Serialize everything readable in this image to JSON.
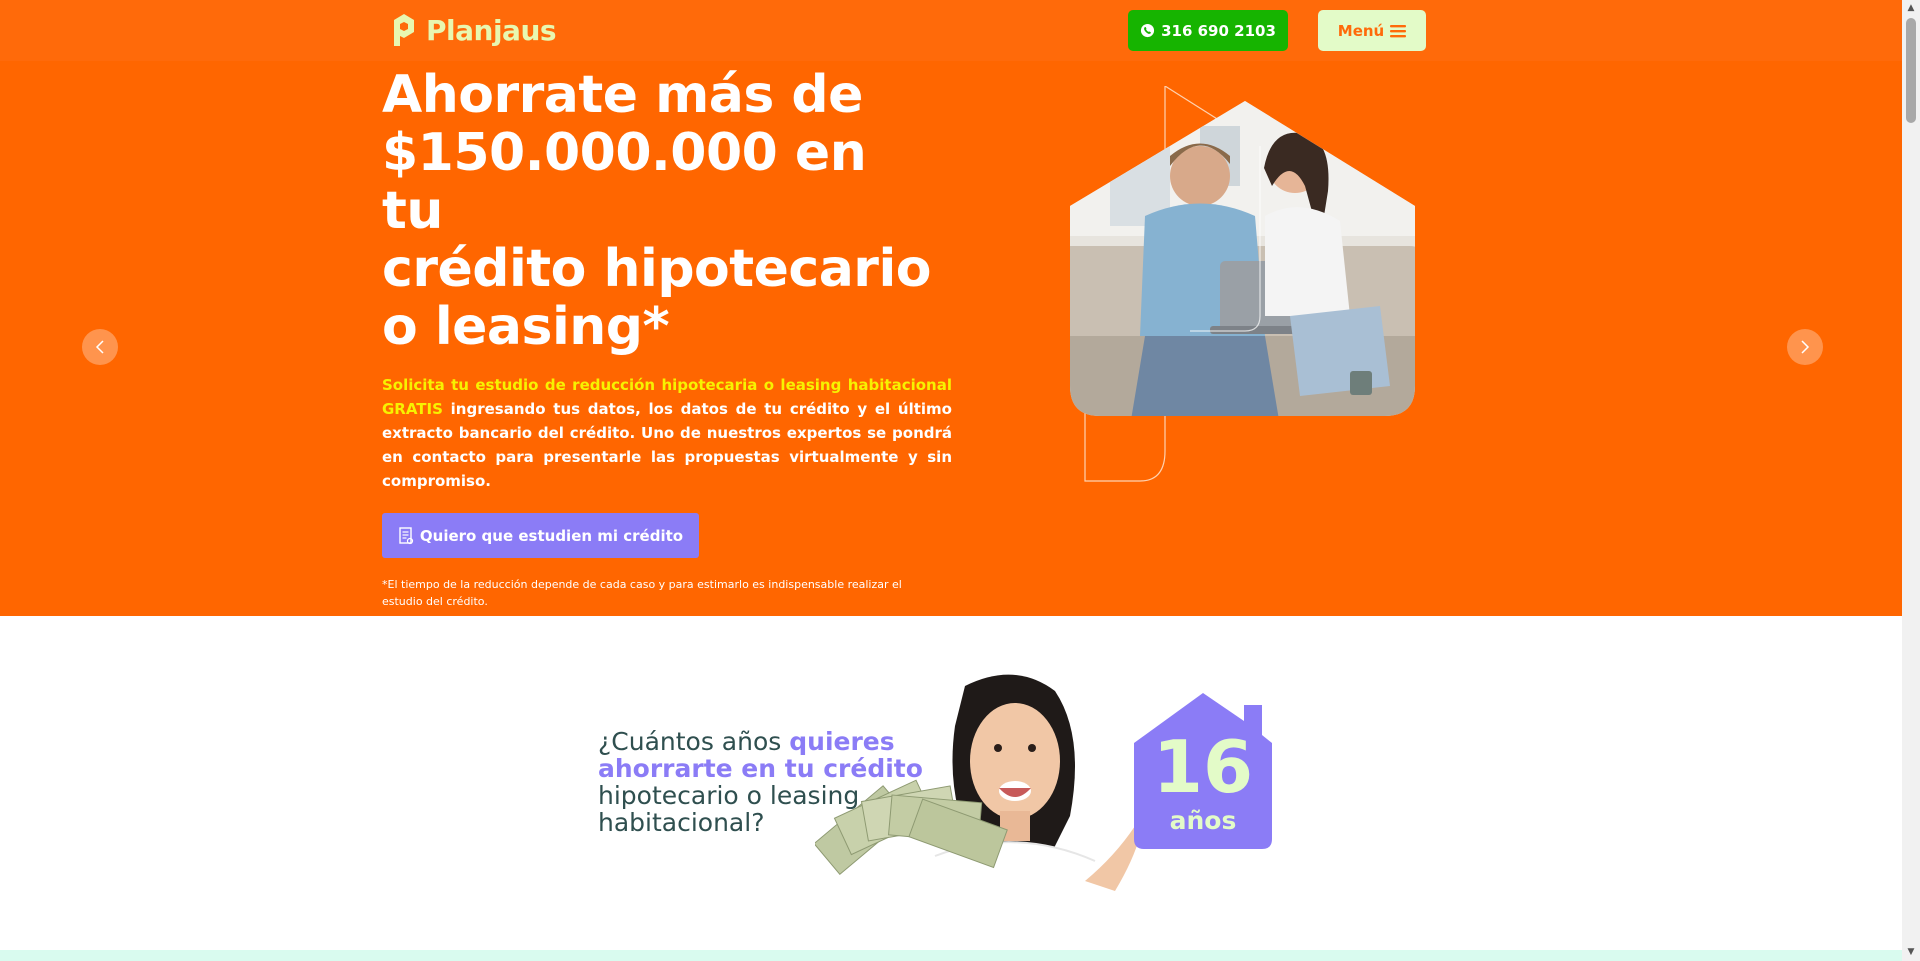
{
  "header": {
    "logo_text": "Planjaus",
    "whatsapp_label": "316 690 2103",
    "menu_label": "Menú"
  },
  "hero": {
    "title_line1": "Ahorrate más de",
    "title_line2": "$150.000.000 en",
    "title_line3": "tu",
    "title_line4": "crédito hipotecario",
    "title_line5": "o leasing*",
    "text_highlight": "Solicita tu estudio de reducción hipotecaria o leasing habitacional GRATIS",
    "text_rest": " ingresando tus datos, los datos de tu crédito y el último extracto bancario del crédito. Uno de nuestros expertos se pondrá en contacto para presentarle las propuestas virtualmente y sin compromiso.",
    "cta_label": "Quiero que estudien mi crédito",
    "disclaimer": "*El tiempo de la reducción depende de cada caso y para estimarlo es indispensable realizar el estudio del crédito."
  },
  "savings": {
    "question_part1": "¿Cuántos años ",
    "question_accent": "quieres ahorrarte en tu crédito",
    "question_part2": " hipotecario o leasing habitacional?",
    "years_number": "16",
    "years_label": "años"
  },
  "colors": {
    "brand_orange": "#ff6600",
    "accent_purple": "#8b7cf6",
    "whatsapp_green": "#16b400",
    "mint": "#e3fbc8"
  }
}
